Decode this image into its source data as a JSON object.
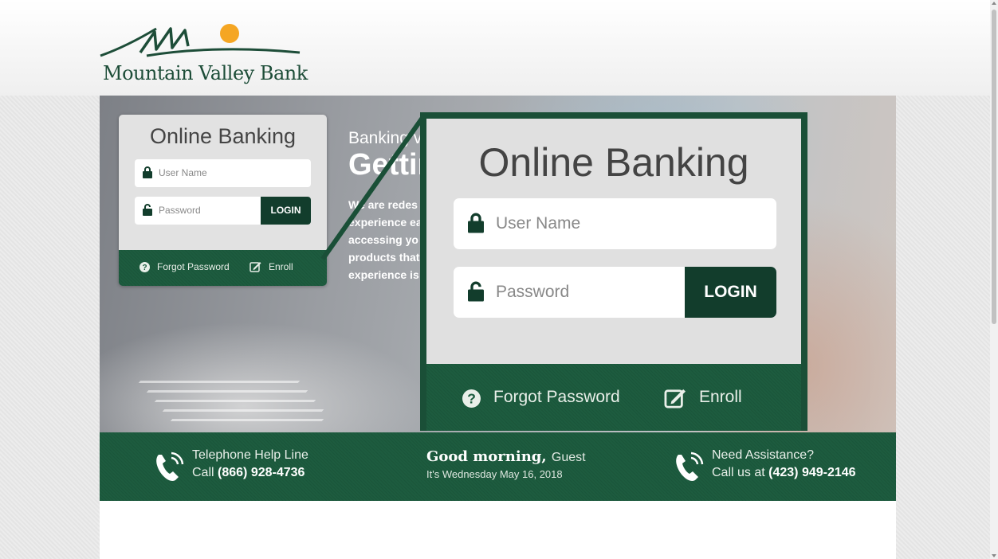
{
  "brand": {
    "name": "Mountain Valley Bank",
    "color": "#1d5c3f",
    "dark_color": "#123d2c",
    "sun_color": "#f5a623"
  },
  "login": {
    "title": "Online Banking",
    "username_placeholder": "User Name",
    "password_placeholder": "Password",
    "login_label": "LOGIN",
    "forgot_label": "Forgot Password",
    "enroll_label": "Enroll"
  },
  "hero": {
    "kicker": "Banking v",
    "headline": "Gettin",
    "para_lines": [
      "We are redes",
      "experience ea",
      "accessing yo",
      "products that",
      "experience is"
    ]
  },
  "footer": {
    "help_line_title": "Telephone Help Line",
    "help_line_prefix": "Call",
    "help_line_number": "(866) 928-4736",
    "greeting": "Good morning,",
    "guest": "Guest",
    "date": "It's Wednesday May 16, 2018",
    "assist_title": "Need Assistance?",
    "assist_prefix": "Call us at",
    "assist_number": "(423) 949-2146"
  },
  "icons": {
    "lock_closed": "lock-icon",
    "lock_open": "unlock-icon",
    "question": "question-circle-icon",
    "edit": "edit-icon",
    "phone": "phone-icon"
  }
}
